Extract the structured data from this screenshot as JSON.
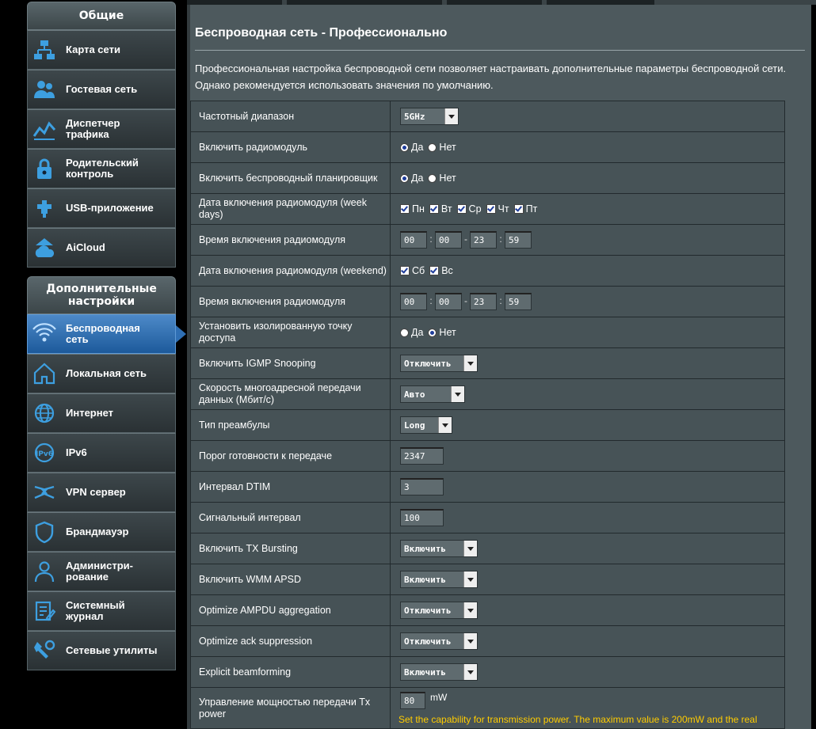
{
  "sidebar": {
    "general_header": "Общие",
    "general_items": [
      {
        "label": [
          "Карта сети"
        ],
        "icon": "network-map-icon"
      },
      {
        "label": [
          "Гостевая сеть"
        ],
        "icon": "guest-network-icon"
      },
      {
        "label": [
          "Диспетчер",
          "трафика"
        ],
        "icon": "traffic-manager-icon"
      },
      {
        "label": [
          "Родительский",
          "контроль"
        ],
        "icon": "parental-control-icon"
      },
      {
        "label": [
          "USB-приложение"
        ],
        "icon": "usb-app-icon"
      },
      {
        "label": [
          "AiCloud"
        ],
        "icon": "aicloud-icon"
      }
    ],
    "advanced_header": [
      "Дополнительные",
      "настройки"
    ],
    "advanced_items": [
      {
        "label": [
          "Беспроводная",
          "сеть"
        ],
        "icon": "wireless-icon",
        "active": true
      },
      {
        "label": [
          "Локальная сеть"
        ],
        "icon": "lan-icon"
      },
      {
        "label": [
          "Интернет"
        ],
        "icon": "internet-globe-icon"
      },
      {
        "label": [
          "IPv6"
        ],
        "icon": "ipv6-icon"
      },
      {
        "label": [
          "VPN сервер"
        ],
        "icon": "vpn-icon"
      },
      {
        "label": [
          "Брандмауэр"
        ],
        "icon": "firewall-shield-icon"
      },
      {
        "label": [
          "Администри-",
          "рование"
        ],
        "icon": "admin-user-icon"
      },
      {
        "label": [
          "Системный",
          "журнал"
        ],
        "icon": "system-log-icon"
      },
      {
        "label": [
          "Сетевые утилиты"
        ],
        "icon": "network-tools-icon"
      }
    ]
  },
  "main": {
    "title": "Беспроводная сеть - Профессионально",
    "description": "Профессиональная настройка беспроводной сети позволяет настраивать дополнительные параметры беспроводной сети. Однако рекомендуется использовать значения по умолчанию."
  },
  "options": {
    "yes": "Да",
    "no": "Нет",
    "days": [
      "Пн",
      "Вт",
      "Ср",
      "Чт",
      "Пт"
    ],
    "weekend": [
      "Сб",
      "Вс"
    ]
  },
  "settings": [
    {
      "label": "Частотный диапазон",
      "type": "select",
      "value": "5GHz",
      "width": 74
    },
    {
      "label": "Включить радиомодуль",
      "type": "radio",
      "selected": "yes"
    },
    {
      "label": "Включить беспроводный планировщик",
      "type": "radio",
      "selected": "yes"
    },
    {
      "label": "Дата включения радиомодуля (week days)",
      "type": "days"
    },
    {
      "label": "Время включения радиомодуля",
      "type": "time",
      "values": [
        "00",
        "00",
        "23",
        "59"
      ]
    },
    {
      "label": "Дата включения радиомодуля (weekend)",
      "type": "weekend"
    },
    {
      "label": "Время включения радиомодуля",
      "type": "time",
      "values": [
        "00",
        "00",
        "23",
        "59"
      ]
    },
    {
      "label": "Установить изолированную точку доступа",
      "type": "radio",
      "selected": "no"
    },
    {
      "label": "Включить IGMP Snooping",
      "type": "select",
      "value": "Отключить",
      "width": 98
    },
    {
      "label": "Скорость многоадресной передачи данных (Мбит/с)",
      "type": "select",
      "value": "Авто",
      "width": 82
    },
    {
      "label": "Тип преамбулы",
      "type": "select",
      "value": "Long",
      "width": 66
    },
    {
      "label": "Порог готовности к передаче",
      "type": "text",
      "value": "2347"
    },
    {
      "label": "Интервал DTIM",
      "type": "text",
      "value": "3"
    },
    {
      "label": "Сигнальный интервал",
      "type": "text",
      "value": "100"
    },
    {
      "label": "Включить TX Bursting",
      "type": "select",
      "value": "Включить",
      "width": 98
    },
    {
      "label": "Включить WMM APSD",
      "type": "select",
      "value": "Включить",
      "width": 98
    },
    {
      "label": "Optimize AMPDU aggregation",
      "type": "select",
      "value": "Отключить",
      "width": 98
    },
    {
      "label": "Optimize ack suppression",
      "type": "select",
      "value": "Отключить",
      "width": 98
    },
    {
      "label": "Explicit beamforming",
      "type": "select",
      "value": "Включить",
      "width": 98
    },
    {
      "label": "Управление мощностью передачи Tx power",
      "type": "power",
      "value": "80",
      "unit": "mW",
      "hint": "Set the capability for transmission power. The maximum value is 200mW and the real"
    }
  ],
  "colors": {
    "accent": "#2f6fb4",
    "hint": "#ffcc00",
    "panel": "#4d595d"
  }
}
